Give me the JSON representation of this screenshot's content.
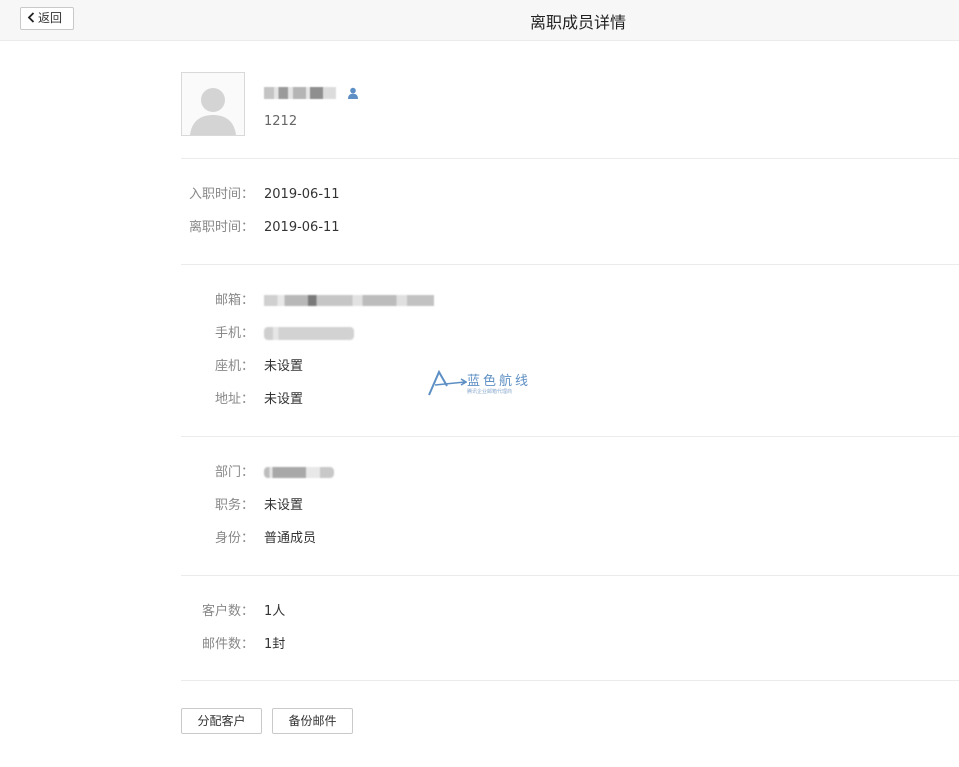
{
  "header": {
    "back_label": "返回",
    "title": "离职成员详情"
  },
  "profile": {
    "account": "1212",
    "avatar_icon": "default-user-avatar-icon",
    "role_icon": "user-icon",
    "accent_color": "#5d8fc4"
  },
  "employment": {
    "join_label": "入职时间：",
    "join_value": "2019-06-11",
    "leave_label": "离职时间：",
    "leave_value": "2019-06-11"
  },
  "contact": {
    "email_label": "邮箱：",
    "mobile_label": "手机：",
    "landline_label": "座机：",
    "landline_value": "未设置",
    "address_label": "地址：",
    "address_value": "未设置"
  },
  "org": {
    "dept_label": "部门：",
    "position_label": "职务：",
    "position_value": "未设置",
    "identity_label": "身份：",
    "identity_value": "普通成员"
  },
  "stats": {
    "customers_label": "客户数：",
    "customers_value": "1人",
    "mails_label": "邮件数：",
    "mails_value": "1封"
  },
  "actions": {
    "assign_label": "分配客户",
    "backup_label": "备份邮件"
  },
  "watermark": {
    "text": "蓝色航线",
    "subtext": "腾讯企业邮箱代理商"
  }
}
